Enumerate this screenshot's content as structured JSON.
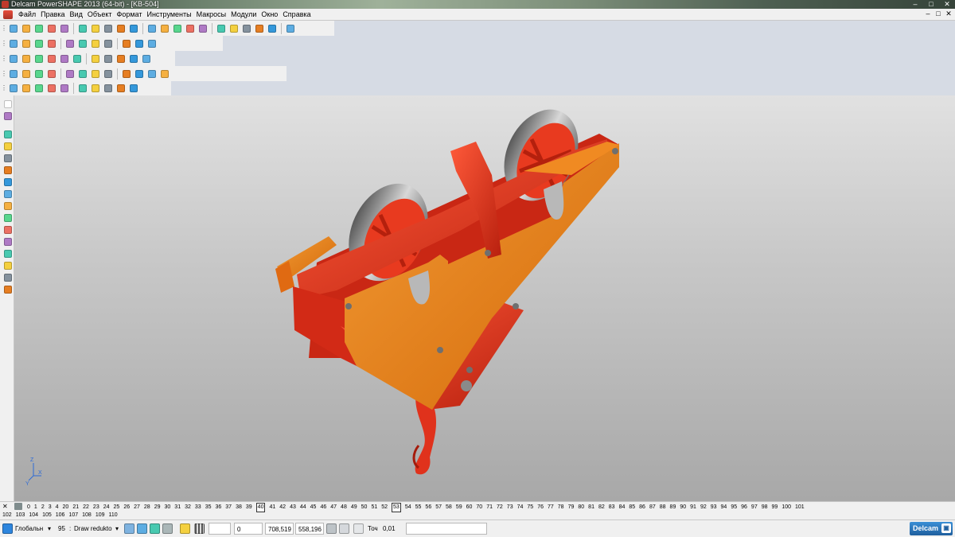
{
  "window": {
    "title": "Delcam PowerSHAPE 2013 (64-bit) - [KB-504]",
    "controls": [
      "–",
      "□",
      "✕"
    ]
  },
  "menu": [
    "Файл",
    "Правка",
    "Вид",
    "Объект",
    "Формат",
    "Инструменты",
    "Макросы",
    "Модули",
    "Окно",
    "Справка"
  ],
  "mdi_controls": [
    "–",
    "□",
    "✕"
  ],
  "levels": {
    "row1": [
      "0",
      "1",
      "2",
      "3",
      "4",
      "20",
      "21",
      "22",
      "23",
      "24",
      "25",
      "26",
      "27",
      "28",
      "29",
      "30",
      "31",
      "32",
      "33",
      "35",
      "36",
      "37",
      "38",
      "39",
      "40",
      "41",
      "42",
      "43",
      "44",
      "45",
      "46",
      "47",
      "48",
      "49",
      "50",
      "51",
      "52",
      "53",
      "54",
      "55",
      "56",
      "57",
      "58",
      "59",
      "60",
      "70",
      "71",
      "72",
      "73",
      "74",
      "75",
      "76",
      "77",
      "78",
      "79",
      "80",
      "81",
      "82",
      "83",
      "84",
      "85",
      "86",
      "87",
      "88",
      "89",
      "90",
      "91",
      "92",
      "93",
      "94",
      "95",
      "96",
      "97",
      "98",
      "99",
      "100",
      "101"
    ],
    "row2": [
      "102",
      "103",
      "104",
      "105",
      "106",
      "107",
      "108",
      "109",
      "110"
    ],
    "active": [
      "40",
      "53"
    ]
  },
  "status": {
    "workplane": "Глобальн",
    "level_number": "95",
    "level_name": "Draw redukto",
    "coord1": "0",
    "coord_x": "708,519",
    "coord_y": "558,196",
    "tolerance_label": "Точ",
    "tolerance_value": "0,01",
    "logo": "Delcam"
  },
  "colors": {
    "model_red": "#e0321c",
    "model_orange": "#e87a10",
    "wheel_gray": "#8a8a8a",
    "background_top": "#e1e1e1",
    "background_bottom": "#a8a8a8"
  },
  "icons": {
    "toolbar1": [
      "layers-icon",
      "open-icon",
      "save-icon",
      "print-icon",
      "cut-icon",
      "copy-icon",
      "paste-icon",
      "delete-icon",
      "undo-icon",
      "redo-icon",
      "redo-all-icon",
      "select-icon",
      "line-icon",
      "arc-icon",
      "circle-icon",
      "curve-icon",
      "surface-icon",
      "solid-icon",
      "shade-icon",
      "wireframe-icon",
      "measure-icon"
    ],
    "toolbar2": [
      "model-icon",
      "sphere-icon",
      "cone-icon",
      "cylinder-icon",
      "extrude-icon",
      "revolve-icon",
      "boolean-icon",
      "fillet-icon",
      "chamfer-icon",
      "shell-icon",
      "feature-icon"
    ],
    "toolbar3": [
      "view-top-icon",
      "view-front-icon",
      "view-right-icon",
      "view-iso1-icon",
      "view-iso2-icon",
      "view-iso3-icon",
      "view-iso4-icon",
      "zoom-icon",
      "zoom-fit-icon",
      "pan-icon",
      "rotate-icon",
      "section-icon"
    ],
    "toolbar4": [
      "assembly-icon",
      "component-icon",
      "mate-icon",
      "align-icon",
      "distance-icon",
      "angle-icon",
      "coaxial-icon",
      "tangent-icon",
      "fix-icon",
      "explode-icon"
    ],
    "left": [
      "pointer-icon",
      "wireframe-tool-icon",
      "curve-tool-icon",
      "arc-tool-icon",
      "circle-tool-icon",
      "line-tool-icon",
      "text-tool-icon",
      "dimension-tool-icon",
      "surface-tool-icon",
      "solid-tool-icon",
      "feature-tool-icon",
      "electrode-tool-icon",
      "mesh-tool-icon",
      "workplane-tool-icon",
      "symbol-tool-icon",
      "lathe-tool-icon"
    ]
  },
  "axis_labels": {
    "x": "X",
    "y": "Y",
    "z": "Z"
  }
}
